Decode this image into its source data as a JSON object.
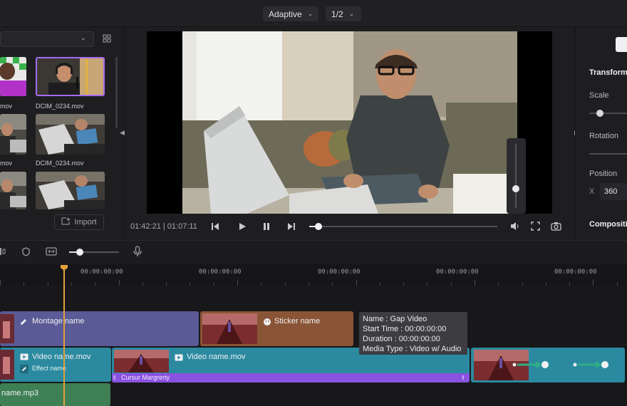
{
  "topbar": {
    "quality_dropdown": "Adaptive",
    "resolution_dropdown": "1/2"
  },
  "media": {
    "items": [
      {
        "label": "mov"
      },
      {
        "label": "DCIM_0234.mov"
      },
      {
        "label": "mov"
      },
      {
        "label": "DCIM_0234.mov"
      }
    ],
    "import_label": "Import"
  },
  "player": {
    "time_display": "01:42:21 | 01:07:11",
    "progress": 0.05,
    "volume_level": 0.3
  },
  "properties": {
    "transform_header": "Transform",
    "scale_label": "Scale",
    "rotation_label": "Rotation",
    "position_label": "Position",
    "x_label": "X",
    "x_value": "360",
    "compositing_header": "Compositi"
  },
  "timeline": {
    "ruler_labels": [
      "00:00:00:00",
      "00:00:00:00",
      "00:00:00:00",
      "00:00:00:00",
      "00:00:00:00"
    ],
    "clips": {
      "montage": "Montage name",
      "sticker": "Sticker name",
      "video1": "Video name.mov",
      "video1_effect": "Effect name",
      "video2": "Video name.mov",
      "cursor_label": "Cursur Margrerty",
      "audio": "name.mp3"
    },
    "tooltip": {
      "name": "Name : Gap Video",
      "start": "Start Time : 00:00:00:00",
      "duration": "Duration : 00:00:00:00",
      "media_type": "Media Type : Video w/ Audio"
    }
  },
  "colors": {
    "montage": "#5a5a96",
    "sticker": "#8a5536",
    "video": "#2b8aa0",
    "audio": "#3f7f54",
    "cursor_bar": "#8a52e0",
    "playhead": "#e2a03a",
    "keyframe_arrow": "#2fae84"
  }
}
